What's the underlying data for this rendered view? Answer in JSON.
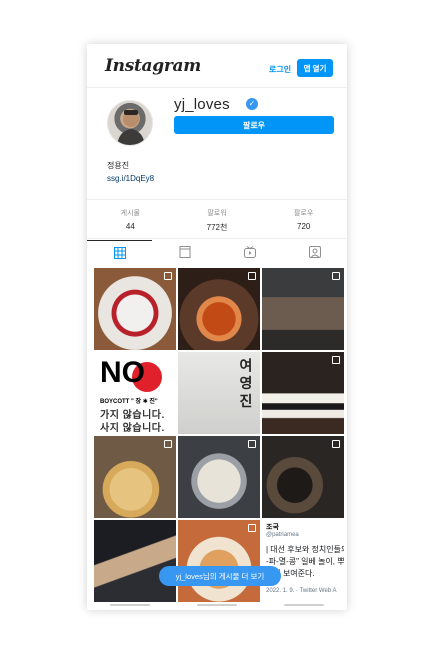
{
  "header": {
    "logo": "Instagram",
    "login": "로그인",
    "open_app": "앱 열기"
  },
  "profile": {
    "username": "yj_loves",
    "verified": "✓",
    "follow": "팔로우",
    "full_name": "정용진",
    "link": "ssg.i/1DqEy8"
  },
  "stats": [
    {
      "label": "게시물",
      "value": "44"
    },
    {
      "label": "팔로워",
      "value": "772천"
    },
    {
      "label": "팔로우",
      "value": "720"
    }
  ],
  "tabs": [
    {
      "icon": "grid-icon"
    },
    {
      "icon": "feed-icon"
    },
    {
      "icon": "igtv-icon"
    },
    {
      "icon": "tagged-icon"
    }
  ],
  "posts": {
    "boycott": {
      "no": "NO",
      "title": "BOYCOTT \" 장 ✱ 진\"",
      "line1": "가지 않습니다.",
      "line2": "사지 않습니다."
    },
    "vertical_text": "여 영 진",
    "tweet": {
      "name": "조국",
      "handle": "@patriamea",
      "line1": "| 대선 후보와 정치인들의",
      "line2": "-파-멸-콩\" 일베 놀이, 뿌",
      "line3": "이지 보여준다.",
      "meta": "2022. 1. 9. · Twitter Web A"
    }
  },
  "more_button": "yj_loves님의 게시물 더 보기",
  "colors": {
    "accent": "#0095f6",
    "verified": "#3897f0"
  }
}
